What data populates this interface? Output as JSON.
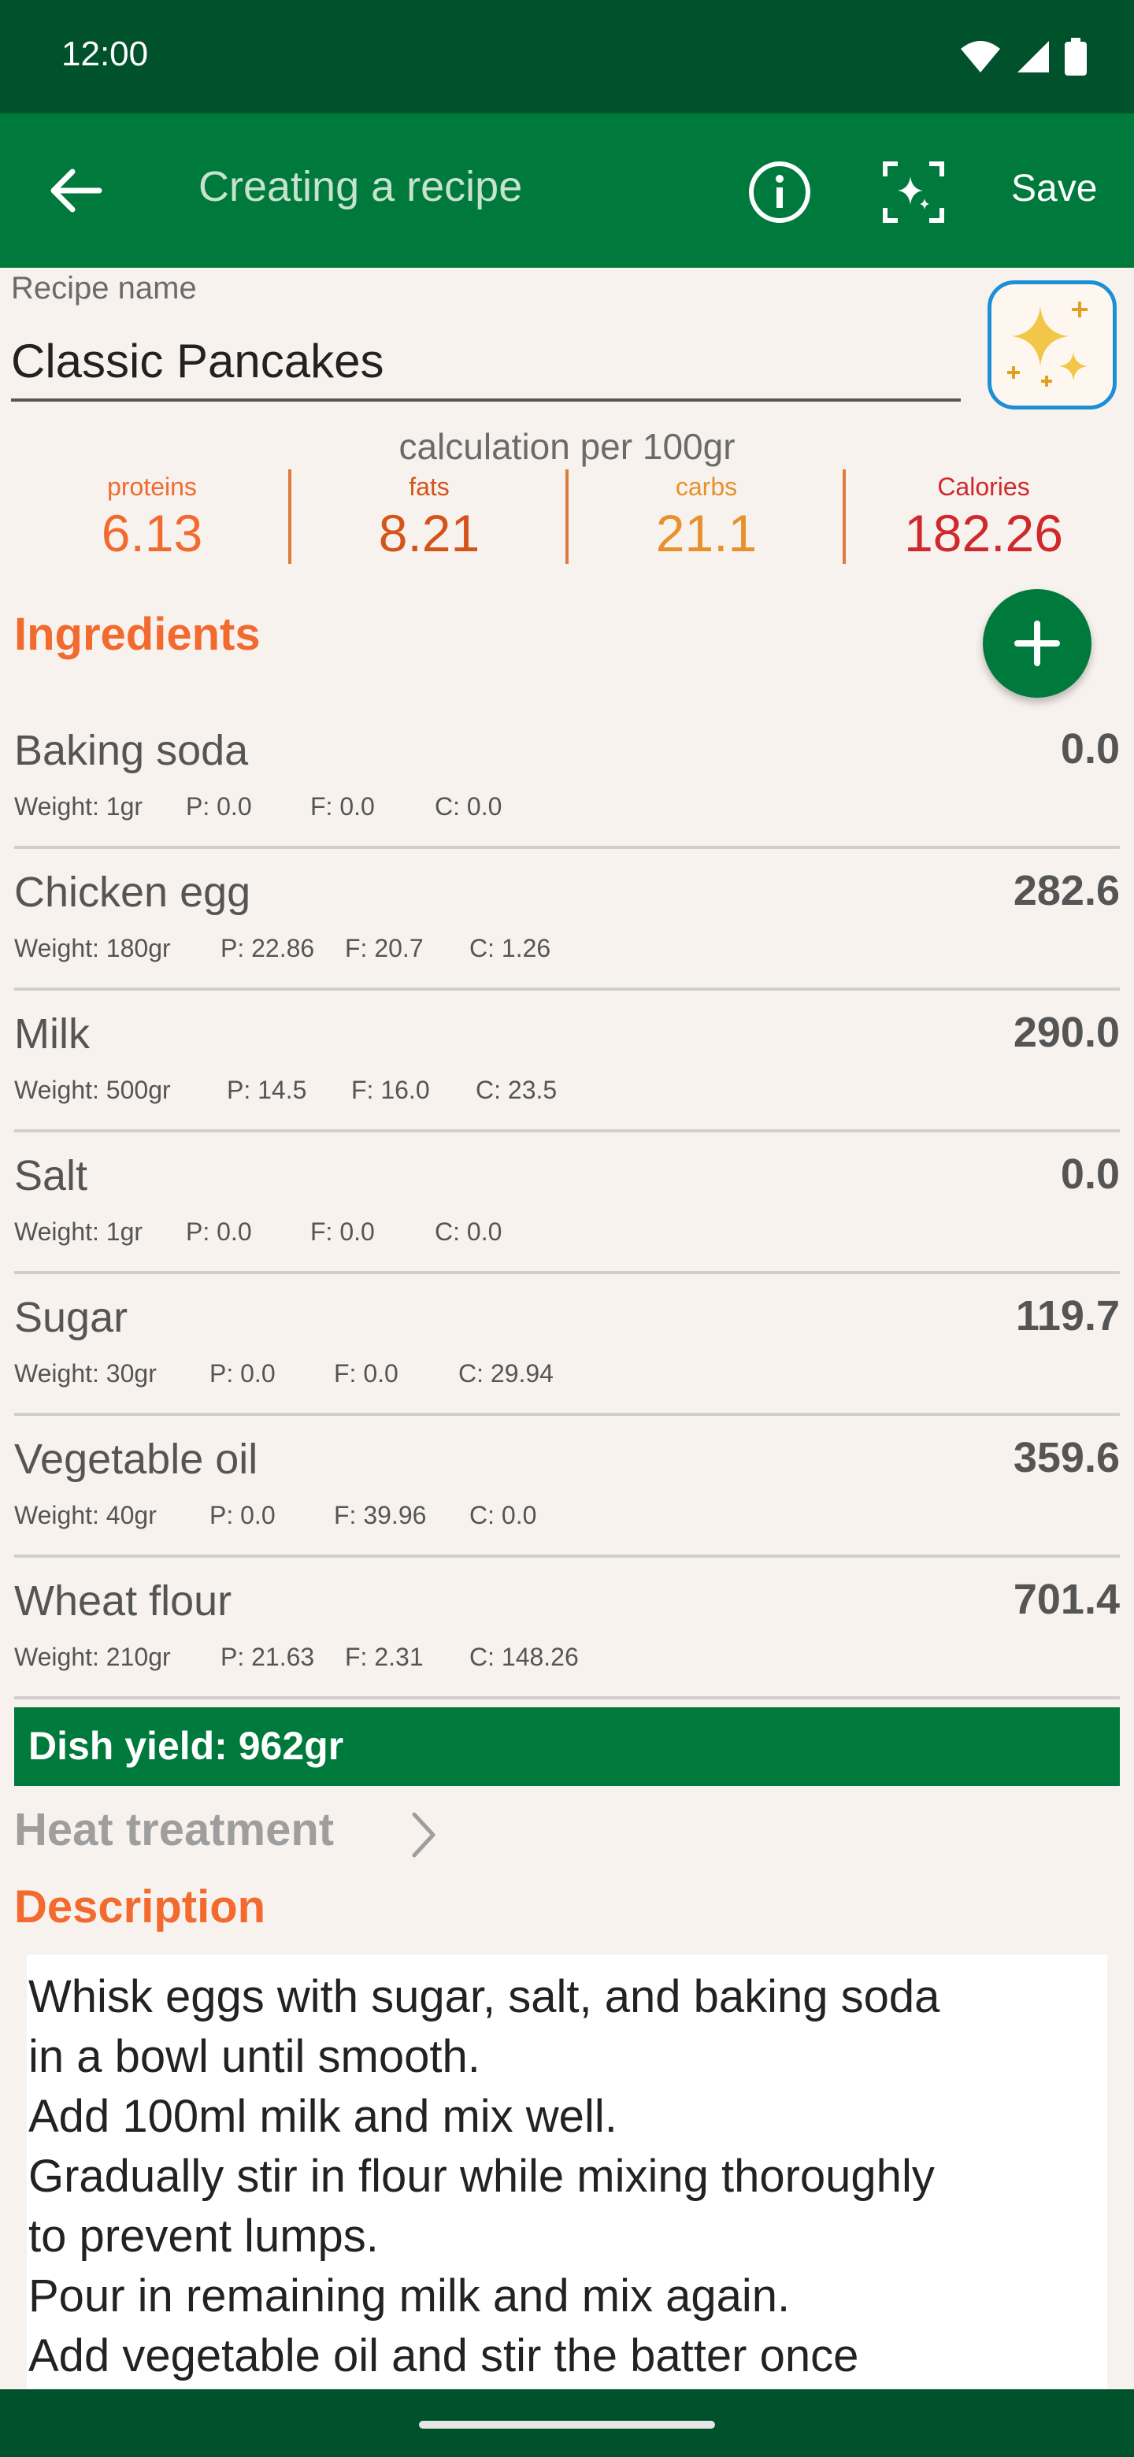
{
  "status": {
    "time": "12:00"
  },
  "appbar": {
    "title": "Creating a recipe",
    "save_label": "Save"
  },
  "recipe": {
    "name_label": "Recipe name",
    "name_value": "Classic Pancakes"
  },
  "calc": {
    "label": "calculation per 100gr",
    "macros": [
      {
        "label": "proteins",
        "value": "6.13",
        "color": "#f26a2e"
      },
      {
        "label": "fats",
        "value": "8.21",
        "color": "#d4541a"
      },
      {
        "label": "carbs",
        "value": "21.1",
        "color": "#e8902c"
      },
      {
        "label": "Calories",
        "value": "182.26",
        "color": "#d0282c"
      }
    ]
  },
  "ingredients": {
    "title": "Ingredients",
    "items": [
      {
        "name": "Baking soda",
        "calories": "0.0",
        "weight": "Weight: 1gr",
        "p": "P: 0.0",
        "f": "F: 0.0",
        "c": "C: 0.0"
      },
      {
        "name": "Chicken egg",
        "calories": "282.6",
        "weight": "Weight: 180gr",
        "p": "P: 22.86",
        "f": "F: 20.7",
        "c": "C: 1.26"
      },
      {
        "name": "Milk",
        "calories": "290.0",
        "weight": "Weight: 500gr",
        "p": "P: 14.5",
        "f": "F: 16.0",
        "c": "C: 23.5"
      },
      {
        "name": "Salt",
        "calories": "0.0",
        "weight": "Weight: 1gr",
        "p": "P: 0.0",
        "f": "F: 0.0",
        "c": "C: 0.0"
      },
      {
        "name": "Sugar",
        "calories": "119.7",
        "weight": "Weight: 30gr",
        "p": "P: 0.0",
        "f": "F: 0.0",
        "c": "C: 29.94"
      },
      {
        "name": "Vegetable oil",
        "calories": "359.6",
        "weight": "Weight: 40gr",
        "p": "P: 0.0",
        "f": "F: 39.96",
        "c": "C: 0.0"
      },
      {
        "name": "Wheat flour",
        "calories": "701.4",
        "weight": "Weight: 210gr",
        "p": "P: 21.63",
        "f": "F: 2.31",
        "c": "C: 148.26"
      }
    ]
  },
  "yield": {
    "label": "Dish yield: 962gr"
  },
  "heat": {
    "label": "Heat treatment"
  },
  "description": {
    "title": "Description",
    "lines": [
      "Whisk eggs with sugar, salt, and baking soda",
      "in a bowl until smooth.",
      "Add 100ml milk and mix well.",
      "Gradually stir in flour while mixing thoroughly",
      "to prevent lumps.",
      "Pour in remaining milk and mix again.",
      "Add vegetable oil and stir the batter once"
    ]
  },
  "icons": {
    "back": "arrow-left-icon",
    "info": "info-icon",
    "scan": "scan-sparkle-icon",
    "ai": "sparkles-icon",
    "add": "plus-icon",
    "chevron": "chevron-right-icon"
  }
}
